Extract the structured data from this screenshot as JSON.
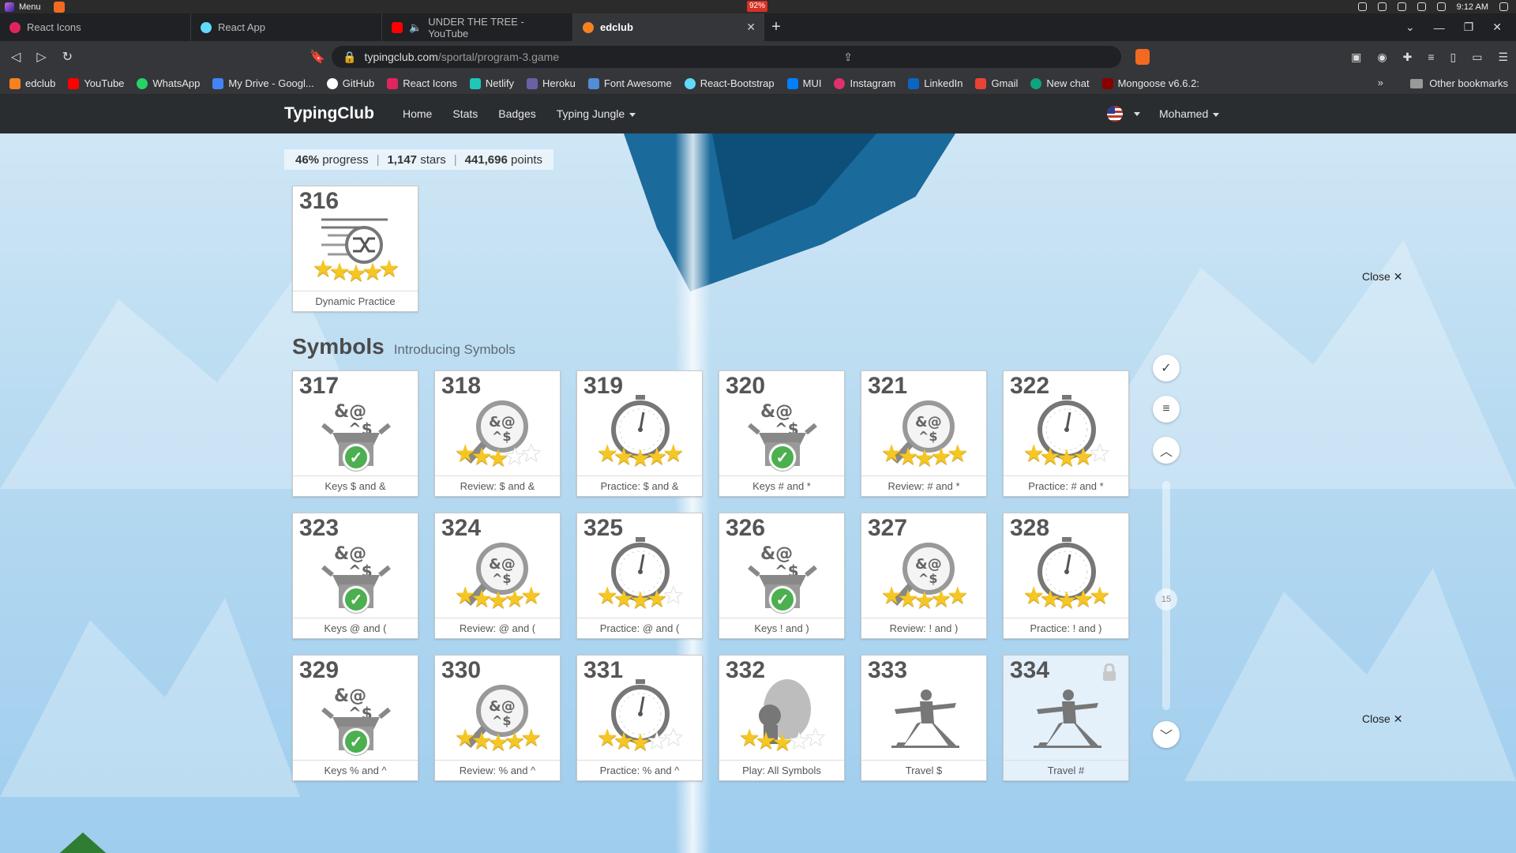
{
  "os": {
    "menu_label": "Menu",
    "battery": "92%",
    "time": "9:12 AM"
  },
  "tabs": [
    {
      "label": "React Icons",
      "color": "#e0245e"
    },
    {
      "label": "React App",
      "color": "#61dafb"
    },
    {
      "label": "UNDER THE TREE - YouTube",
      "color": "#ff0000"
    },
    {
      "label": "edclub",
      "color": "#f5821f"
    }
  ],
  "address": {
    "host": "typingclub.com",
    "path": "/sportal/program-3.game"
  },
  "bookmarks": [
    {
      "label": "edclub",
      "color": "#f5821f"
    },
    {
      "label": "YouTube",
      "color": "#ff0000"
    },
    {
      "label": "WhatsApp",
      "color": "#25d366"
    },
    {
      "label": "My Drive - Googl...",
      "color": "#4285f4"
    },
    {
      "label": "GitHub",
      "color": "#ffffff"
    },
    {
      "label": "React Icons",
      "color": "#e0245e"
    },
    {
      "label": "Netlify",
      "color": "#20c6b7"
    },
    {
      "label": "Heroku",
      "color": "#6762a6"
    },
    {
      "label": "Font Awesome",
      "color": "#528dd7"
    },
    {
      "label": "React-Bootstrap",
      "color": "#61dafb"
    },
    {
      "label": "MUI",
      "color": "#007fff"
    },
    {
      "label": "Instagram",
      "color": "#e1306c"
    },
    {
      "label": "LinkedIn",
      "color": "#0a66c2"
    },
    {
      "label": "Gmail",
      "color": "#ea4335"
    },
    {
      "label": "New chat",
      "color": "#10a37f"
    },
    {
      "label": "Mongoose v6.6.2:",
      "color": "#880000"
    }
  ],
  "other_bookmarks": "Other bookmarks",
  "site": {
    "brand": "TypingClub",
    "nav": [
      "Home",
      "Stats",
      "Badges",
      "Typing Jungle"
    ],
    "user": "Mohamed"
  },
  "stats": {
    "progress_value": "46%",
    "progress_label": "progress",
    "stars_value": "1,147",
    "stars_label": "stars",
    "points_value": "441,696",
    "points_label": "points"
  },
  "section": {
    "title": "Symbols",
    "subtitle": "Introducing Symbols"
  },
  "close_label": "Close",
  "rail_counter": "15",
  "cards": [
    {
      "num": "316",
      "label": "Dynamic Practice",
      "kind": "shuffle",
      "stars": 5
    },
    {
      "num": "317",
      "label": "Keys $ and &",
      "kind": "box",
      "stars": 0
    },
    {
      "num": "318",
      "label": "Review: $ and &",
      "kind": "mag",
      "stars": 3
    },
    {
      "num": "319",
      "label": "Practice: $ and &",
      "kind": "clock",
      "stars": 5
    },
    {
      "num": "320",
      "label": "Keys # and *",
      "kind": "box",
      "stars": 0
    },
    {
      "num": "321",
      "label": "Review: # and *",
      "kind": "mag",
      "stars": 5
    },
    {
      "num": "322",
      "label": "Practice: # and *",
      "kind": "clock",
      "stars": 4
    },
    {
      "num": "323",
      "label": "Keys @ and (",
      "kind": "box",
      "stars": 0
    },
    {
      "num": "324",
      "label": "Review: @ and (",
      "kind": "mag",
      "stars": 5
    },
    {
      "num": "325",
      "label": "Practice: @ and (",
      "kind": "clock",
      "stars": 4
    },
    {
      "num": "326",
      "label": "Keys ! and )",
      "kind": "box",
      "stars": 0
    },
    {
      "num": "327",
      "label": "Review: ! and )",
      "kind": "mag",
      "stars": 5
    },
    {
      "num": "328",
      "label": "Practice: ! and )",
      "kind": "clock",
      "stars": 5
    },
    {
      "num": "329",
      "label": "Keys % and ^",
      "kind": "box",
      "stars": 0
    },
    {
      "num": "330",
      "label": "Review: % and ^",
      "kind": "mag",
      "stars": 5
    },
    {
      "num": "331",
      "label": "Practice: % and ^",
      "kind": "clock",
      "stars": 3
    },
    {
      "num": "332",
      "label": "Play: All Symbols",
      "kind": "game",
      "stars": 3
    },
    {
      "num": "333",
      "label": "Travel $",
      "kind": "yoga",
      "stars": -1
    },
    {
      "num": "334",
      "label": "Travel #",
      "kind": "yoga",
      "stars": -1,
      "locked": true
    }
  ]
}
